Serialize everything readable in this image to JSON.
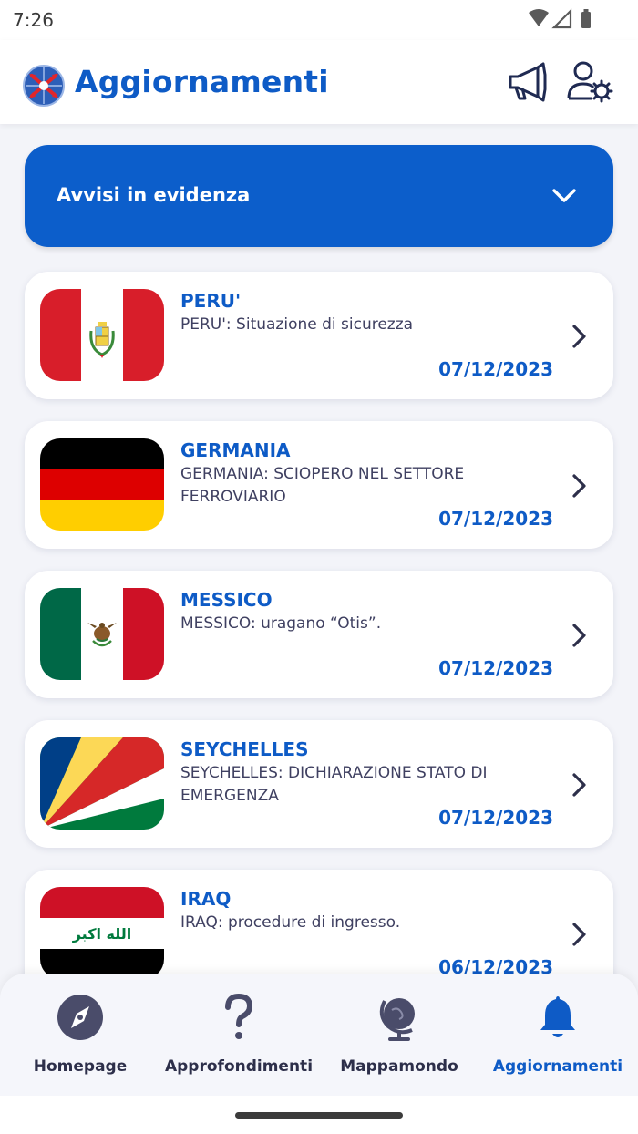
{
  "status_bar": {
    "time": "7:26"
  },
  "header": {
    "title": "Aggiornamenti",
    "logo_icon": "crossed-arrows-globe-logo",
    "actions": [
      {
        "icon": "megaphone-icon"
      },
      {
        "icon": "user-settings-icon"
      }
    ]
  },
  "banner": {
    "label": "Avvisi in evidenza",
    "icon": "chevron-down-icon",
    "color": "#0c5ecb"
  },
  "notices": [
    {
      "country": "PERU'",
      "description": "PERU': Situazione di sicurezza",
      "date": "07/12/2023",
      "flag": "peru-flag"
    },
    {
      "country": "GERMANIA",
      "description": "GERMANIA: SCIOPERO NEL SETTORE FERROVIARIO",
      "date": "07/12/2023",
      "flag": "germany-flag"
    },
    {
      "country": "MESSICO",
      "description": "MESSICO: uragano “Otis”.",
      "date": "07/12/2023",
      "flag": "mexico-flag"
    },
    {
      "country": "SEYCHELLES",
      "description": "SEYCHELLES: DICHIARAZIONE STATO DI EMERGENZA",
      "date": "07/12/2023",
      "flag": "seychelles-flag"
    },
    {
      "country": "IRAQ",
      "description": "IRAQ: procedure di ingresso.",
      "date": "06/12/2023",
      "flag": "iraq-flag",
      "flag_text": "الله اكبر"
    }
  ],
  "bottom_nav": [
    {
      "label": "Homepage",
      "icon": "compass-icon",
      "active": false
    },
    {
      "label": "Approfondimenti",
      "icon": "question-mark-icon",
      "active": false
    },
    {
      "label": "Mappamondo",
      "icon": "globe-icon",
      "active": false
    },
    {
      "label": "Aggiornamenti",
      "icon": "bell-icon",
      "active": true
    }
  ],
  "colors": {
    "accent": "#0e5bc6",
    "background": "#f3f4f9",
    "text": "#3f4061"
  }
}
